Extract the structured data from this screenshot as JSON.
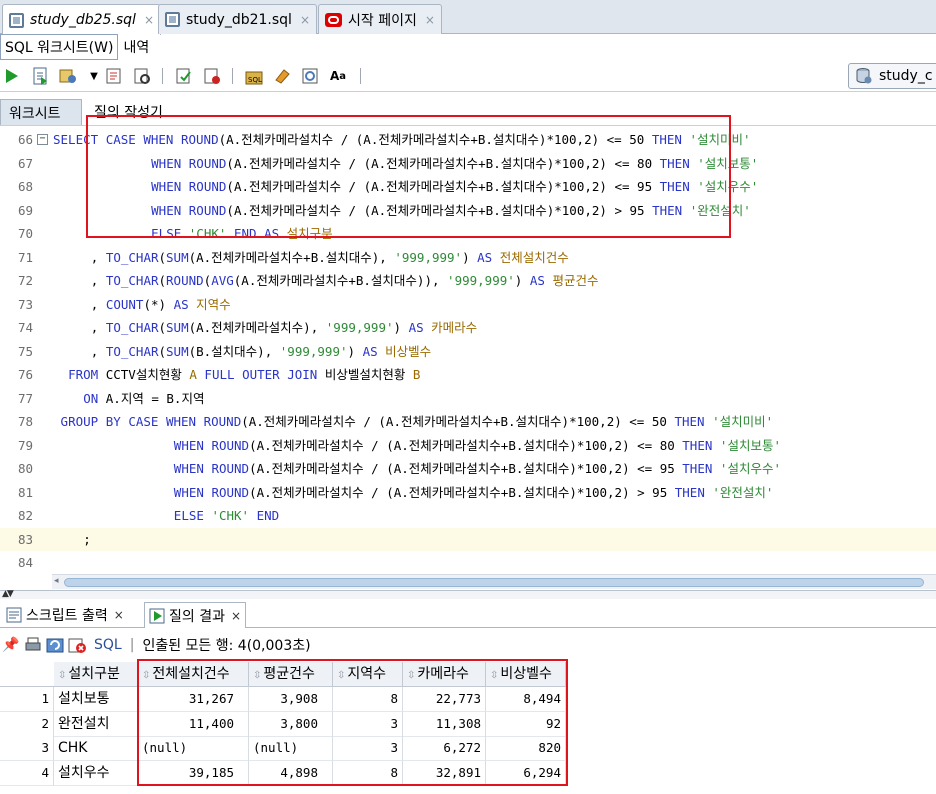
{
  "doc_tabs": [
    {
      "label": "study_db25.sql",
      "icon": "sql-file-icon",
      "active": true
    },
    {
      "label": "study_db21.sql",
      "icon": "sql-file-icon",
      "active": false
    },
    {
      "label": "시작 페이지",
      "icon": "oracle-icon",
      "active": false
    }
  ],
  "close_glyph": "×",
  "sub_tabs": [
    "SQL 워크시트(W)",
    "내역"
  ],
  "connection": "study_c",
  "worksheet_tabs": [
    "워크시트",
    "질의 작성기"
  ],
  "code_lines": [
    {
      "n": "66",
      "indent": 0,
      "text": "SELECT CASE WHEN ROUND(A.전체카메라설치수 / (A.전체카메라설치수+B.설치대수)*100,2) <= 50 THEN '설치미비'"
    },
    {
      "n": "67",
      "indent": 13,
      "text": "WHEN ROUND(A.전체카메라설치수 / (A.전체카메라설치수+B.설치대수)*100,2) <= 80 THEN '설치보통'"
    },
    {
      "n": "68",
      "indent": 13,
      "text": "WHEN ROUND(A.전체카메라설치수 / (A.전체카메라설치수+B.설치대수)*100,2) <= 95 THEN '설치우수'"
    },
    {
      "n": "69",
      "indent": 13,
      "text": "WHEN ROUND(A.전체카메라설치수 / (A.전체카메라설치수+B.설치대수)*100,2) > 95 THEN '완전설치'"
    },
    {
      "n": "70",
      "indent": 13,
      "text": "ELSE 'CHK' END AS 설치구분"
    },
    {
      "n": "71",
      "indent": 5,
      "text": ", TO_CHAR(SUM(A.전체카메라설치수+B.설치대수), '999,999') AS 전체설치건수"
    },
    {
      "n": "72",
      "indent": 5,
      "text": ", TO_CHAR(ROUND(AVG(A.전체카메라설치수+B.설치대수)), '999,999') AS 평균건수"
    },
    {
      "n": "73",
      "indent": 5,
      "text": ", COUNT(*) AS 지역수"
    },
    {
      "n": "74",
      "indent": 5,
      "text": ", TO_CHAR(SUM(A.전체카메라설치수), '999,999') AS 카메라수"
    },
    {
      "n": "75",
      "indent": 5,
      "text": ", TO_CHAR(SUM(B.설치대수), '999,999') AS 비상벨수"
    },
    {
      "n": "76",
      "indent": 2,
      "text": "FROM CCTV설치현황 A FULL OUTER JOIN 비상벨설치현황 B"
    },
    {
      "n": "77",
      "indent": 4,
      "text": "ON A.지역 = B.지역"
    },
    {
      "n": "78",
      "indent": 1,
      "text": "GROUP BY CASE WHEN ROUND(A.전체카메라설치수 / (A.전체카메라설치수+B.설치대수)*100,2) <= 50 THEN '설치미비'"
    },
    {
      "n": "79",
      "indent": 16,
      "text": "WHEN ROUND(A.전체카메라설치수 / (A.전체카메라설치수+B.설치대수)*100,2) <= 80 THEN '설치보통'"
    },
    {
      "n": "80",
      "indent": 16,
      "text": "WHEN ROUND(A.전체카메라설치수 / (A.전체카메라설치수+B.설치대수)*100,2) <= 95 THEN '설치우수'"
    },
    {
      "n": "81",
      "indent": 16,
      "text": "WHEN ROUND(A.전체카메라설치수 / (A.전체카메라설치수+B.설치대수)*100,2) > 95 THEN '완전설치'"
    },
    {
      "n": "82",
      "indent": 16,
      "text": "ELSE 'CHK' END"
    },
    {
      "n": "83",
      "indent": 4,
      "text": ";"
    },
    {
      "n": "84",
      "indent": 0,
      "text": ""
    }
  ],
  "current_line": "83",
  "bottom_tabs": [
    {
      "label": "스크립트 출력",
      "active": false
    },
    {
      "label": "질의 결과",
      "active": true
    }
  ],
  "results_toolbar": {
    "sql_label": "SQL",
    "status": "인출된 모든 행: 4(0,003초)"
  },
  "grid": {
    "columns": [
      "설치구분",
      "전체설치건수",
      "평균건수",
      "지역수",
      "카메라수",
      "비상벨수"
    ],
    "rows": [
      [
        "1",
        "설치보통",
        "31,267",
        "3,908",
        "8",
        "22,773",
        "8,494"
      ],
      [
        "2",
        "완전설치",
        "11,400",
        "3,800",
        "3",
        "11,308",
        "92"
      ],
      [
        "3",
        "CHK",
        "(null)",
        "(null)",
        "3",
        "6,272",
        "820"
      ],
      [
        "4",
        "설치우수",
        "39,185",
        "4,898",
        "8",
        "32,891",
        "6,294"
      ]
    ]
  },
  "accent": {
    "highlight_box": "#e0141e",
    "keyword": "#2a35c8",
    "string": "#2e8a36"
  }
}
